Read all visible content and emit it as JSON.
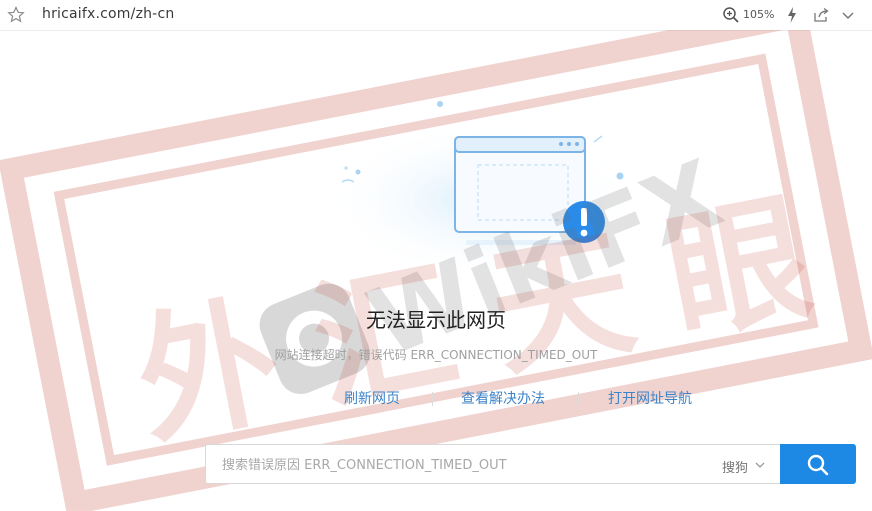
{
  "browser": {
    "url": "hricaifx.com/zh-cn",
    "zoom": "105%"
  },
  "error": {
    "title": "无法显示此网页",
    "detail": "网站连接超时，错误代码 ERR_CONNECTION_TIMED_OUT"
  },
  "actions": {
    "refresh": "刷新网页",
    "solutions": "查看解决办法",
    "nav": "打开网址导航"
  },
  "search": {
    "placeholder": "搜索错误原因 ERR_CONNECTION_TIMED_OUT",
    "engine": "搜狗"
  },
  "watermark": {
    "brand": "WikiFX",
    "stamp": "外汇天眼"
  },
  "colors": {
    "accent": "#1e88e5",
    "link": "#3e84c8",
    "stamp": "#c0392b"
  }
}
